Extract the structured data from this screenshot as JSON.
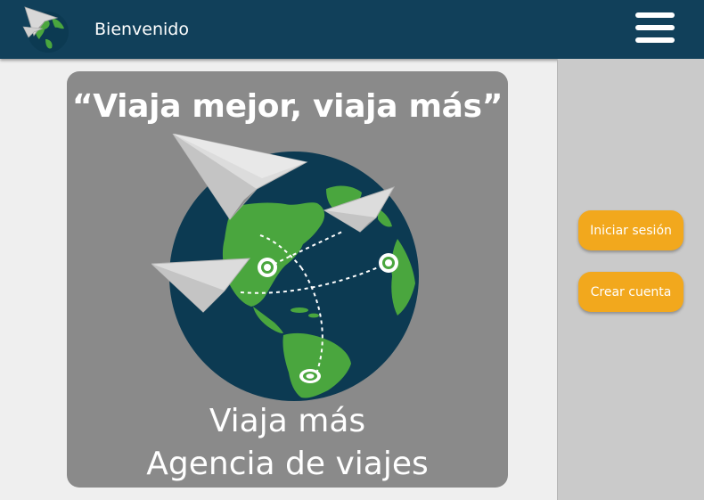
{
  "header": {
    "title": "Bienvenido",
    "logo_icon": "globe-paper-plane-icon",
    "menu_icon": "hamburger-menu-icon"
  },
  "hero": {
    "slogan": "“Viaja mejor, viaja más”",
    "name": "Viaja más",
    "tagline": "Agencia de viajes",
    "illustration": "globe-with-paper-planes"
  },
  "sidebar": {
    "login_label": "Iniciar sesión",
    "signup_label": "Crear cuenta"
  },
  "colors": {
    "header_bg": "#11405a",
    "card_bg": "#8a8a8a",
    "sidebar_bg": "#cacaca",
    "button_bg": "#f2a81d",
    "ocean": "#0c3a52",
    "land": "#4aa63e"
  }
}
